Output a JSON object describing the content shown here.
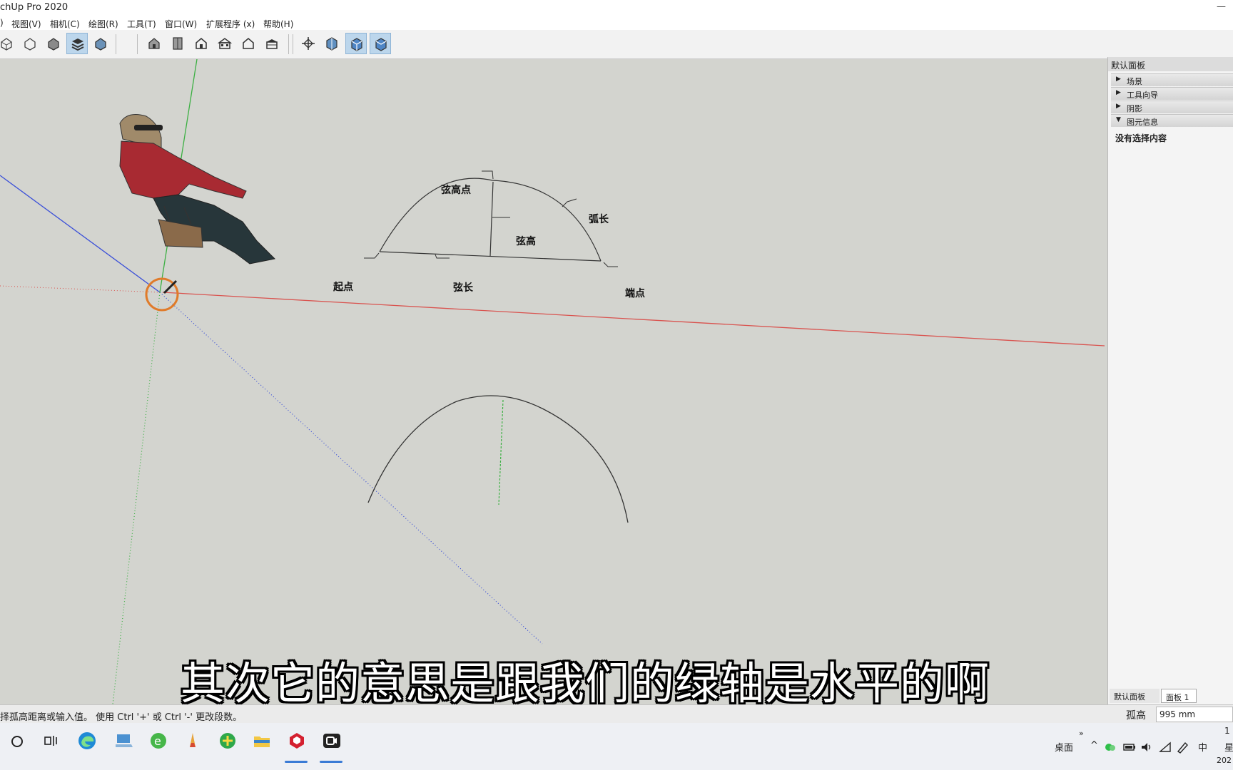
{
  "window": {
    "title": "chUp Pro 2020",
    "minimize": "—"
  },
  "menu": [
    "视图(V)",
    "相机(C)",
    "绘图(R)",
    "工具(T)",
    "窗口(W)",
    "扩展程序 (x)",
    "帮助(H)"
  ],
  "menu_leading": ")",
  "diagram": {
    "labels": {
      "chord_high_point": "弦高点",
      "arc_length": "弧长",
      "chord_height": "弦高",
      "start_point": "起点",
      "chord_length": "弦长",
      "end_point": "端点"
    }
  },
  "panel": {
    "title": "默认面板",
    "sections": [
      {
        "arrow": "▶",
        "label": "场景"
      },
      {
        "arrow": "▶",
        "label": "工具向导"
      },
      {
        "arrow": "▶",
        "label": "阴影"
      },
      {
        "arrow": "▼",
        "label": "图元信息"
      }
    ],
    "entity_info": "没有选择内容",
    "tabs": [
      "默认面板",
      "面板 1"
    ]
  },
  "status": {
    "message": "择孤高距离或输入值。 使用 Ctrl '+' 或 Ctrl '-' 更改段数。",
    "value_label": "孤高",
    "value": "995 mm"
  },
  "subtitle": "其次它的意思是跟我们的绿轴是水平的啊",
  "taskbar": {
    "desktop": "桌面",
    "lang": "中",
    "overflow": "»",
    "time_partial": "1",
    "date_partial": "202",
    "weekday_partial": "星",
    "chevron": "^"
  },
  "colors": {
    "red_axis": "#d9534f",
    "green_axis": "#3cb043",
    "blue_axis": "#3a4fd8",
    "accent": "#3a7bd5"
  }
}
